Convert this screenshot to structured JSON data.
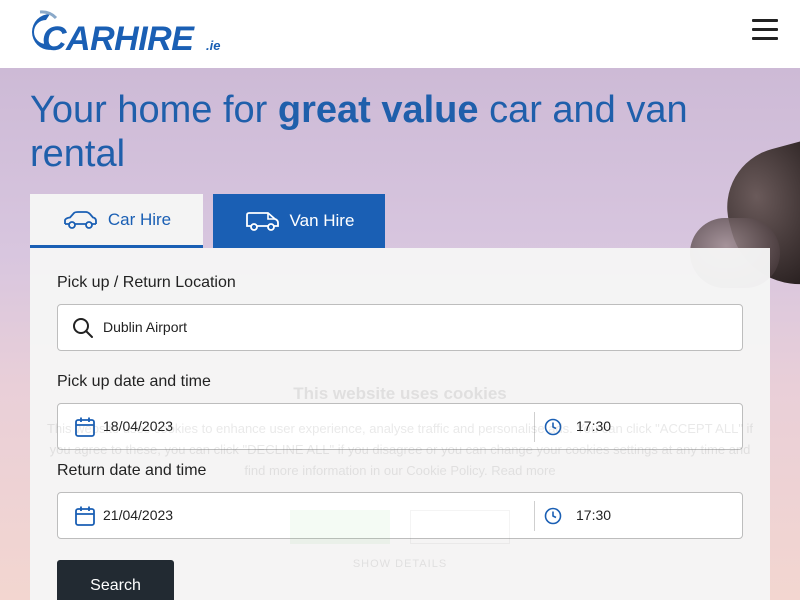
{
  "header": {
    "logo_text": "CARHIRE",
    "logo_tld": ".ie"
  },
  "hero": {
    "headline_pre": "Your home for ",
    "headline_bold": "great value",
    "headline_post": " car and van rental"
  },
  "tabs": [
    {
      "label": "Car Hire",
      "active": true
    },
    {
      "label": "Van Hire",
      "active": false
    }
  ],
  "form": {
    "location_label": "Pick up / Return Location",
    "location_value": "Dublin Airport",
    "pickup_label": "Pick up date and time",
    "pickup_date": "18/04/2023",
    "pickup_time": "17:30",
    "return_label": "Return date and time",
    "return_date": "21/04/2023",
    "return_time": "17:30",
    "search_label": "Search"
  },
  "cookie": {
    "title": "This website uses cookies",
    "text": "This website uses cookies to enhance user experience, analyse traffic and personalise ads. You can click \"ACCEPT ALL\" if you agree to these, you can click \"DECLINE ALL\" if you disagree or you can change your cookies settings at any time and find more information in our Cookie Policy. Read more",
    "details": "SHOW DETAILS"
  },
  "colors": {
    "brand": "#1a5fb4",
    "button_dark": "#222a32"
  }
}
